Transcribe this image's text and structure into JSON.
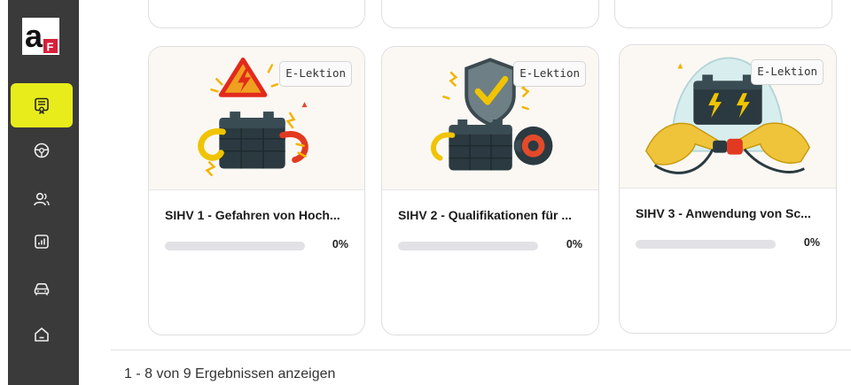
{
  "app": {
    "logo_letter": "a",
    "logo_badge": "F"
  },
  "sidebar": {
    "items": [
      {
        "icon": "certificate-icon",
        "active": true
      },
      {
        "icon": "wheel-icon",
        "active": false
      },
      {
        "icon": "users-icon",
        "active": false
      },
      {
        "icon": "chart-icon",
        "active": false
      },
      {
        "icon": "car-icon",
        "active": false
      },
      {
        "icon": "home-icon",
        "active": false
      }
    ]
  },
  "courses": [
    {
      "badge": "E-Lektion",
      "title": "SIHV 1 - Gefahren von Hoch...",
      "progress_percent": 0,
      "progress_label": "0%",
      "illustration": "warning-battery-icon"
    },
    {
      "badge": "E-Lektion",
      "title": "SIHV 2 - Qualifikationen für ...",
      "progress_percent": 0,
      "progress_label": "0%",
      "illustration": "shield-battery-icon"
    },
    {
      "badge": "E-Lektion",
      "title": "SIHV 3 - Anwendung von Sc...",
      "progress_percent": 0,
      "progress_label": "0%",
      "illustration": "gloves-battery-icon"
    }
  ],
  "pagination": {
    "summary": "1 - 8 von 9 Ergebnissen anzeigen"
  },
  "colors": {
    "sidebar_bg": "#3a3a3a",
    "active_bg": "#e8ec1b",
    "logo_red": "#d8203a"
  }
}
